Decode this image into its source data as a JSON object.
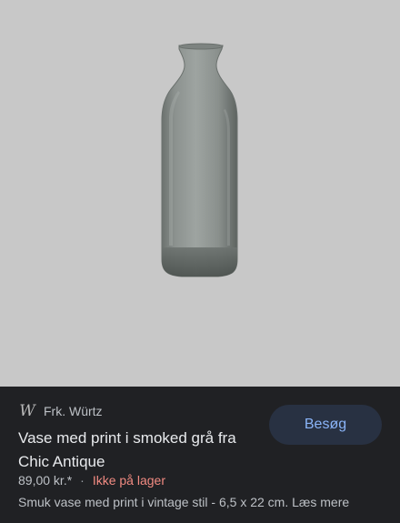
{
  "source": {
    "logo_letter": "W",
    "name": "Frk. Würtz"
  },
  "product": {
    "title": "Vase med print i smoked grå fra Chic Antique",
    "price": "89,00 kr.*",
    "separator": "·",
    "stock_status": "Ikke på lager",
    "description": "Smuk vase med print i vintage stil - 6,5 x 22 cm. Læs mere"
  },
  "actions": {
    "visit_label": "Besøg"
  },
  "colors": {
    "image_background": "#c8c8c8",
    "panel_background": "#202124",
    "button_background": "#283142",
    "button_text": "#8ab4f8",
    "stock_status": "#f28b82"
  }
}
